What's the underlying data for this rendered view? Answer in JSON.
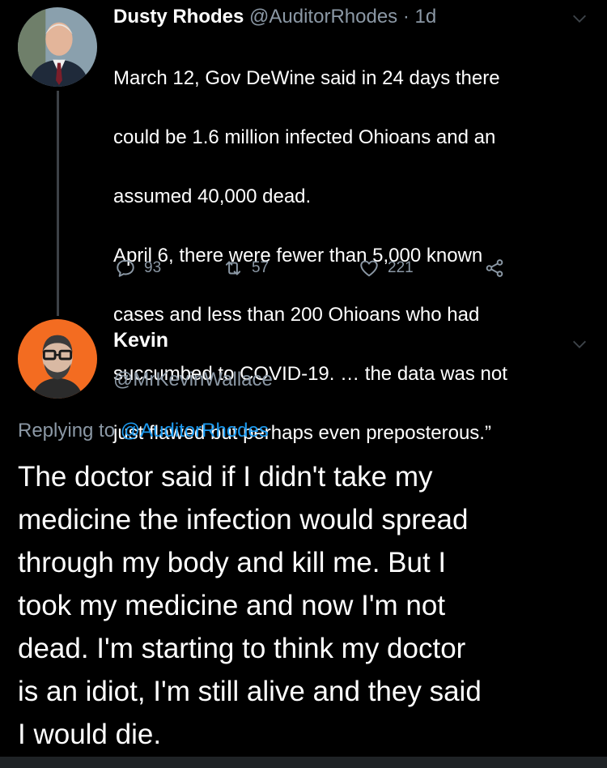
{
  "parent_tweet": {
    "display_name": "Dusty Rhodes",
    "handle": "@AuditorRhodes",
    "separator": "·",
    "timestamp": "1d",
    "lines": [
      "March 12, Gov DeWine said in 24 days there",
      "could be 1.6 million infected Ohioans and an",
      "assumed 40,000 dead.",
      "April 6, there were fewer than 5,000 known",
      "cases and less than 200 Ohioans who had",
      "succumbed to COVID-19. … the data was not",
      "just flawed but perhaps even preposterous.”"
    ],
    "reply_count": "93",
    "retweet_count": "57",
    "like_count": "221",
    "icons": [
      "reply-icon",
      "retweet-icon",
      "like-icon",
      "share-icon",
      "chevron-down-icon"
    ]
  },
  "reply_tweet": {
    "display_name": "Kevin",
    "handle": "@MrKevinWallace",
    "replying_prefix": "Replying to",
    "replying_to": "@AuditorRhodes",
    "lines": [
      "The doctor said if I didn't take my",
      "medicine the infection would spread",
      "through my body and kill me. But I",
      "took my medicine and now I'm not",
      "dead. I'm starting to think my doctor",
      "is an idiot, I'm still alive and they said",
      "I would die."
    ]
  },
  "colors": {
    "background": "#000000",
    "text": "#ffffff",
    "muted": "#8b98a5",
    "link": "#1d9bf0",
    "avatar_orange": "#f36c21"
  }
}
